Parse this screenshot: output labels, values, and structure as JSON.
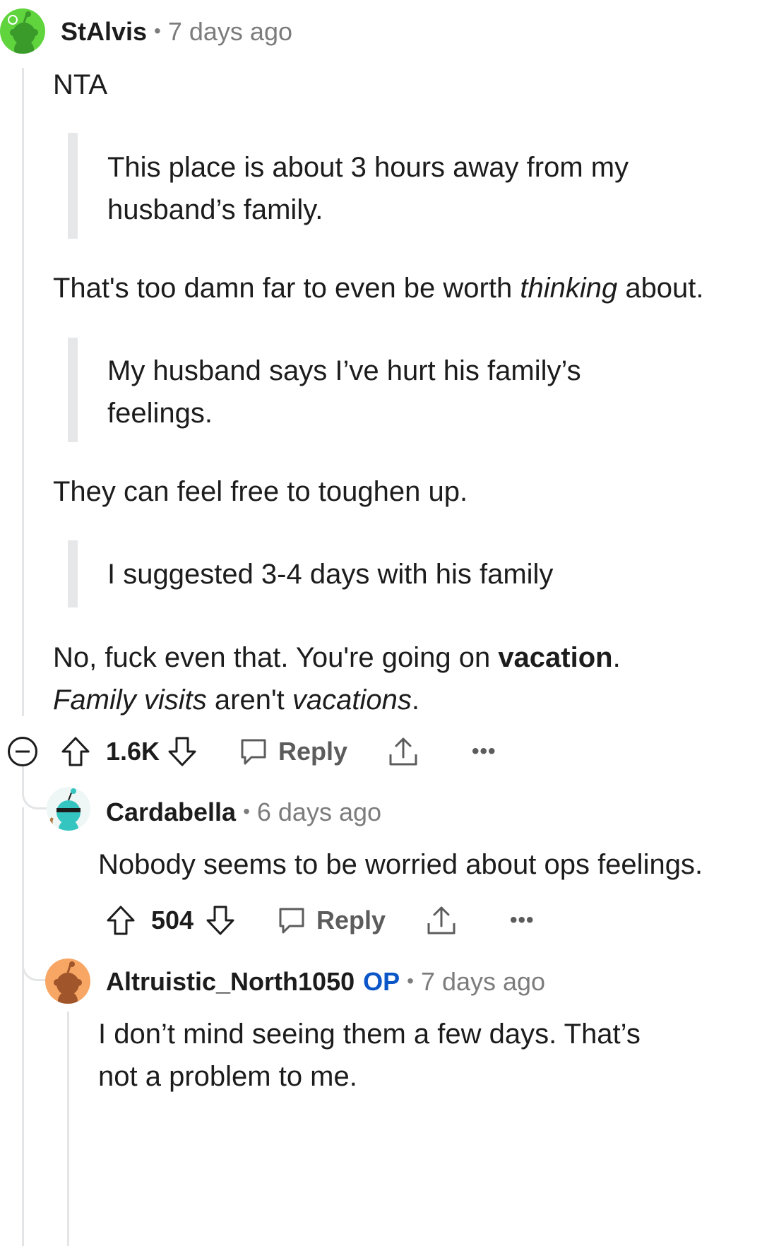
{
  "comments": [
    {
      "user": "StAlvis",
      "separator": "•",
      "time": "7 days ago",
      "body": {
        "p1": "NTA",
        "q1": "This place is about 3 hours away from my husband’s family.",
        "p2_a": "That's too damn far to even be worth ",
        "p2_b": "thinking",
        "p2_c": " about.",
        "q2": "My husband says I’ve hurt his family’s feelings.",
        "p3": "They can feel free to toughen up.",
        "q3": "I suggested 3-4 days with his family",
        "p4_a": "No, fuck even that. You're going on ",
        "p4_b": "vacation",
        "p4_c": ". ",
        "p4_d": "Family visits",
        "p4_e": " aren't ",
        "p4_f": "vacations",
        "p4_g": "."
      },
      "votes": "1.6K",
      "reply_label": "Reply",
      "more_label": "•••"
    },
    {
      "user": "Cardabella",
      "separator": "•",
      "time": "6 days ago",
      "body": "Nobody seems to be worried about ops feelings.",
      "votes": "504",
      "reply_label": "Reply",
      "more_label": "•••"
    },
    {
      "user": "Altruistic_North1050",
      "badge": "OP",
      "separator": "•",
      "time": "7 days ago",
      "body": "I don’t mind seeing them a few days. That’s not a problem to me."
    }
  ],
  "icons": {
    "collapse": "collapse-minus-icon",
    "upvote": "upvote-arrow-icon",
    "downvote": "downvote-arrow-icon",
    "reply": "reply-bubble-icon",
    "share": "share-upload-icon",
    "more": "more-dots-icon"
  },
  "colors": {
    "avatar_green": "#5fd43d",
    "avatar_teal": "#35c5c0",
    "avatar_orange": "#f7a664",
    "op_blue": "#0a55c7",
    "meta_gray": "#7c7c7c",
    "thread_line": "#e3e5e7"
  }
}
